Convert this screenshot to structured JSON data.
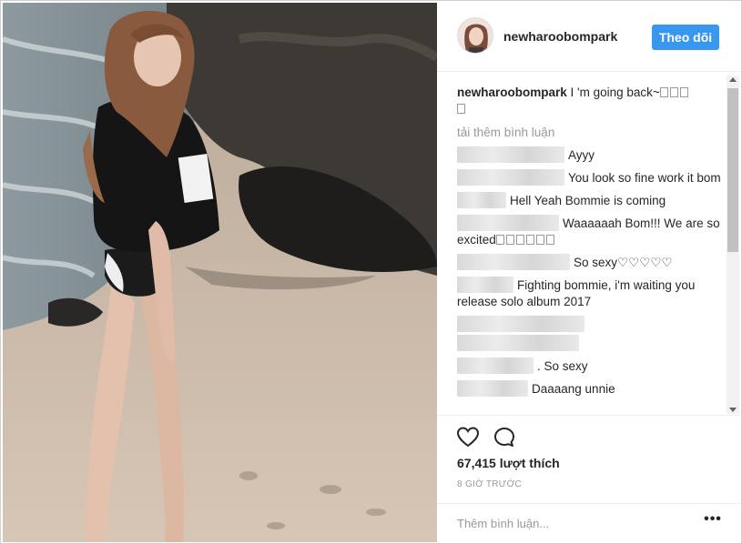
{
  "post": {
    "username": "newharoobompark",
    "follow_label": "Theo dõi",
    "caption_user": "newharoobompark",
    "caption_text": "I 'm going back~",
    "load_more": "tải thêm bình luận",
    "comments": [
      {
        "text": "Ayyy"
      },
      {
        "text": "You look so fine work it bom"
      },
      {
        "text": "Hell Yeah  Bommie is coming"
      },
      {
        "text": "Waaaaaah Bom!!! We are so excited"
      },
      {
        "text": "So sexy♡♡♡♡♡"
      },
      {
        "text": "Fighting bommie, i'm waiting you release solo album 2017"
      },
      {
        "text": ". So sexy"
      },
      {
        "text": "Daaaang unnie"
      }
    ],
    "likes": "67,415 lượt thích",
    "time": "8 GIỜ TRƯỚC",
    "comment_placeholder": "Thêm bình luận...",
    "more_label": "•••"
  },
  "icons": {
    "like": "heart-icon",
    "comment": "comment-bubble-icon",
    "more": "more-options-icon"
  },
  "colors": {
    "accent": "#3897f0",
    "muted": "#999999",
    "text": "#262626"
  }
}
